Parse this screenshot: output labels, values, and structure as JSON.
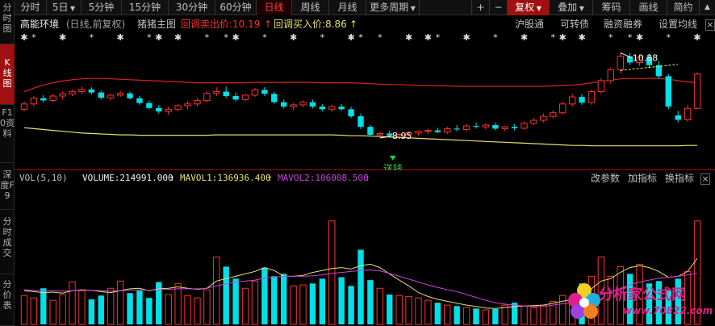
{
  "left_tabs": [
    {
      "label": "分时图",
      "active": false
    },
    {
      "label": "K线图",
      "active": true
    },
    {
      "label": "F10资料",
      "active": false
    },
    {
      "label": "深度F9",
      "active": false
    },
    {
      "label": "分时成交",
      "active": false
    },
    {
      "label": "分价表",
      "active": false
    }
  ],
  "periods": [
    "分时",
    "5日",
    "5分钟",
    "15分钟",
    "30分钟",
    "60分钟",
    "日线",
    "周线",
    "月线",
    "更多周期"
  ],
  "active_period": "日线",
  "toolbar": {
    "plus": "+",
    "minus": "−",
    "fuquan": "复权",
    "overlay": "叠加",
    "chips": "筹码",
    "drawline": "画线",
    "simple": "简约",
    "collapse": "▲"
  },
  "info": {
    "stock_name": "高能环境",
    "mode": "(日线,前复权)",
    "indicator": "猪猪主图",
    "sell_label": "回调卖出价:10.19",
    "buy_label": "回调买入价:8.86",
    "up_arrow": "↑",
    "right_links": [
      "沪股通",
      "可转债",
      "融资融券",
      "设置均线"
    ],
    "close": "×"
  },
  "chart_annotations": {
    "high_label": "10.88",
    "low_label": "8.95",
    "signal_label": "送钱"
  },
  "volume": {
    "indicator": "VOL(5,10)",
    "volume_label": "VOLUME:214991.000",
    "mavol1_label": "MAVOL1:136936.400",
    "mavol2_label": "MAVOL2:106008.500",
    "arrow": "↑",
    "tools": [
      "改参数",
      "加指标",
      "换指标"
    ],
    "close": "×"
  },
  "watermark": {
    "name": "分析家公式网",
    "url": "www.70822.com"
  },
  "colors": {
    "up": "#ff3030",
    "down": "#00e0e8",
    "ma_red": "#e02020",
    "ma_yellow": "#e8e070",
    "mavol1": "#e8e070",
    "mavol2": "#d040e0",
    "accent": "#a01010"
  },
  "chart_data": {
    "type": "candlestick",
    "price_min": 8.6,
    "price_max": 11.2,
    "candles": [
      {
        "o": 9.6,
        "h": 9.78,
        "l": 9.55,
        "c": 9.72
      },
      {
        "o": 9.72,
        "h": 9.9,
        "l": 9.66,
        "c": 9.85
      },
      {
        "o": 9.85,
        "h": 9.92,
        "l": 9.75,
        "c": 9.8
      },
      {
        "o": 9.8,
        "h": 9.95,
        "l": 9.76,
        "c": 9.9
      },
      {
        "o": 9.9,
        "h": 10.0,
        "l": 9.82,
        "c": 9.95
      },
      {
        "o": 9.95,
        "h": 10.05,
        "l": 9.9,
        "c": 10.0
      },
      {
        "o": 10.0,
        "h": 10.12,
        "l": 9.95,
        "c": 10.05
      },
      {
        "o": 10.05,
        "h": 10.1,
        "l": 9.93,
        "c": 9.98
      },
      {
        "o": 9.98,
        "h": 10.02,
        "l": 9.82,
        "c": 9.86
      },
      {
        "o": 9.86,
        "h": 9.95,
        "l": 9.8,
        "c": 9.92
      },
      {
        "o": 9.92,
        "h": 10.02,
        "l": 9.88,
        "c": 9.96
      },
      {
        "o": 9.96,
        "h": 10.0,
        "l": 9.82,
        "c": 9.85
      },
      {
        "o": 9.85,
        "h": 9.9,
        "l": 9.7,
        "c": 9.74
      },
      {
        "o": 9.74,
        "h": 9.8,
        "l": 9.6,
        "c": 9.63
      },
      {
        "o": 9.63,
        "h": 9.7,
        "l": 9.5,
        "c": 9.55
      },
      {
        "o": 9.55,
        "h": 9.66,
        "l": 9.48,
        "c": 9.6
      },
      {
        "o": 9.6,
        "h": 9.72,
        "l": 9.55,
        "c": 9.68
      },
      {
        "o": 9.68,
        "h": 9.78,
        "l": 9.6,
        "c": 9.72
      },
      {
        "o": 9.72,
        "h": 9.86,
        "l": 9.66,
        "c": 9.8
      },
      {
        "o": 9.8,
        "h": 10.02,
        "l": 9.75,
        "c": 9.96
      },
      {
        "o": 9.96,
        "h": 10.1,
        "l": 9.9,
        "c": 10.0
      },
      {
        "o": 10.0,
        "h": 10.12,
        "l": 9.85,
        "c": 9.9
      },
      {
        "o": 9.9,
        "h": 9.98,
        "l": 9.78,
        "c": 9.82
      },
      {
        "o": 9.82,
        "h": 9.95,
        "l": 9.78,
        "c": 9.92
      },
      {
        "o": 9.92,
        "h": 10.08,
        "l": 9.88,
        "c": 10.04
      },
      {
        "o": 10.04,
        "h": 10.1,
        "l": 9.9,
        "c": 9.95
      },
      {
        "o": 9.95,
        "h": 10.0,
        "l": 9.72,
        "c": 9.76
      },
      {
        "o": 9.76,
        "h": 9.82,
        "l": 9.62,
        "c": 9.66
      },
      {
        "o": 9.66,
        "h": 9.74,
        "l": 9.58,
        "c": 9.7
      },
      {
        "o": 9.7,
        "h": 9.8,
        "l": 9.64,
        "c": 9.76
      },
      {
        "o": 9.76,
        "h": 9.82,
        "l": 9.62,
        "c": 9.66
      },
      {
        "o": 9.66,
        "h": 9.72,
        "l": 9.55,
        "c": 9.6
      },
      {
        "o": 9.6,
        "h": 9.7,
        "l": 9.54,
        "c": 9.66
      },
      {
        "o": 9.66,
        "h": 9.72,
        "l": 9.56,
        "c": 9.6
      },
      {
        "o": 9.6,
        "h": 9.66,
        "l": 9.4,
        "c": 9.44
      },
      {
        "o": 9.44,
        "h": 9.5,
        "l": 9.15,
        "c": 9.2
      },
      {
        "o": 9.2,
        "h": 9.24,
        "l": 8.98,
        "c": 9.02
      },
      {
        "o": 9.02,
        "h": 9.08,
        "l": 8.95,
        "c": 9.05
      },
      {
        "o": 9.05,
        "h": 9.12,
        "l": 8.98,
        "c": 9.0
      },
      {
        "o": 9.0,
        "h": 9.06,
        "l": 8.96,
        "c": 9.03
      },
      {
        "o": 9.03,
        "h": 9.1,
        "l": 8.98,
        "c": 9.06
      },
      {
        "o": 9.06,
        "h": 9.12,
        "l": 9.0,
        "c": 9.1
      },
      {
        "o": 9.1,
        "h": 9.16,
        "l": 9.04,
        "c": 9.12
      },
      {
        "o": 9.12,
        "h": 9.18,
        "l": 9.06,
        "c": 9.08
      },
      {
        "o": 9.08,
        "h": 9.2,
        "l": 9.04,
        "c": 9.16
      },
      {
        "o": 9.16,
        "h": 9.24,
        "l": 9.1,
        "c": 9.14
      },
      {
        "o": 9.14,
        "h": 9.26,
        "l": 9.1,
        "c": 9.22
      },
      {
        "o": 9.22,
        "h": 9.3,
        "l": 9.16,
        "c": 9.2
      },
      {
        "o": 9.2,
        "h": 9.28,
        "l": 9.14,
        "c": 9.24
      },
      {
        "o": 9.24,
        "h": 9.3,
        "l": 9.12,
        "c": 9.16
      },
      {
        "o": 9.16,
        "h": 9.22,
        "l": 9.1,
        "c": 9.2
      },
      {
        "o": 9.2,
        "h": 9.26,
        "l": 9.12,
        "c": 9.17
      },
      {
        "o": 9.17,
        "h": 9.32,
        "l": 9.14,
        "c": 9.28
      },
      {
        "o": 9.28,
        "h": 9.4,
        "l": 9.24,
        "c": 9.35
      },
      {
        "o": 9.35,
        "h": 9.5,
        "l": 9.3,
        "c": 9.44
      },
      {
        "o": 9.44,
        "h": 9.58,
        "l": 9.4,
        "c": 9.52
      },
      {
        "o": 9.52,
        "h": 9.78,
        "l": 9.48,
        "c": 9.72
      },
      {
        "o": 9.72,
        "h": 9.95,
        "l": 9.66,
        "c": 9.88
      },
      {
        "o": 9.88,
        "h": 9.95,
        "l": 9.7,
        "c": 9.75
      },
      {
        "o": 9.75,
        "h": 10.05,
        "l": 9.7,
        "c": 10.0
      },
      {
        "o": 10.0,
        "h": 10.3,
        "l": 9.95,
        "c": 10.25
      },
      {
        "o": 10.25,
        "h": 10.55,
        "l": 10.18,
        "c": 10.5
      },
      {
        "o": 10.5,
        "h": 10.88,
        "l": 10.42,
        "c": 10.8
      },
      {
        "o": 10.8,
        "h": 10.88,
        "l": 10.6,
        "c": 10.66
      },
      {
        "o": 10.66,
        "h": 10.85,
        "l": 10.58,
        "c": 10.78
      },
      {
        "o": 10.78,
        "h": 10.86,
        "l": 10.55,
        "c": 10.6
      },
      {
        "o": 10.6,
        "h": 10.7,
        "l": 10.3,
        "c": 10.35
      },
      {
        "o": 10.35,
        "h": 10.4,
        "l": 9.6,
        "c": 9.66
      },
      {
        "o": 9.46,
        "h": 9.56,
        "l": 9.3,
        "c": 9.36
      },
      {
        "o": 9.36,
        "h": 9.7,
        "l": 9.32,
        "c": 9.62
      },
      {
        "o": 9.62,
        "h": 10.44,
        "l": 9.6,
        "c": 10.4
      }
    ],
    "ma_red": [
      10.0,
      10.08,
      10.15,
      10.2,
      10.24,
      10.27,
      10.29,
      10.3,
      10.3,
      10.29,
      10.28,
      10.27,
      10.26,
      10.25,
      10.24,
      10.23,
      10.22,
      10.21,
      10.2,
      10.2,
      10.2,
      10.2,
      10.2,
      10.2,
      10.21,
      10.21,
      10.21,
      10.21,
      10.21,
      10.21,
      10.21,
      10.2,
      10.2,
      10.2,
      10.2,
      10.19,
      10.18,
      10.17,
      10.16,
      10.16,
      10.15,
      10.14,
      10.14,
      10.13,
      10.13,
      10.12,
      10.12,
      10.12,
      10.12,
      10.12,
      10.12,
      10.12,
      10.12,
      10.12,
      10.12,
      10.13,
      10.14,
      10.15,
      10.17,
      10.2,
      10.23,
      10.26,
      10.29,
      10.3,
      10.3,
      10.3,
      10.3,
      10.28,
      10.25,
      10.22,
      10.2
    ],
    "ma_yellow": [
      9.18,
      9.16,
      9.14,
      9.12,
      9.1,
      9.08,
      9.06,
      9.05,
      9.04,
      9.03,
      9.02,
      9.02,
      9.01,
      9.01,
      9.01,
      9.01,
      9.01,
      9.01,
      9.01,
      9.01,
      9.02,
      9.02,
      9.02,
      9.02,
      9.02,
      9.02,
      9.02,
      9.02,
      9.02,
      9.02,
      9.02,
      9.02,
      9.02,
      9.01,
      9.0,
      9.0,
      8.99,
      8.98,
      8.97,
      8.96,
      8.95,
      8.94,
      8.93,
      8.92,
      8.91,
      8.9,
      8.89,
      8.88,
      8.87,
      8.86,
      8.85,
      8.84,
      8.83,
      8.82,
      8.81,
      8.8,
      8.79,
      8.78,
      8.78,
      8.77,
      8.77,
      8.77,
      8.77,
      8.77,
      8.77,
      8.77,
      8.77,
      8.77,
      8.77,
      8.78,
      8.78
    ],
    "volume_max": 280000,
    "volumes": [
      60000,
      55000,
      75000,
      50000,
      62000,
      88000,
      70000,
      52000,
      60000,
      75000,
      90000,
      65000,
      70000,
      55000,
      88000,
      62000,
      85000,
      60000,
      55000,
      72000,
      140000,
      120000,
      95000,
      75000,
      90000,
      118000,
      100000,
      105000,
      80000,
      82000,
      85000,
      95000,
      215000,
      98000,
      80000,
      155000,
      92000,
      75000,
      62000,
      60000,
      58000,
      55000,
      50000,
      45000,
      40000,
      38000,
      35000,
      33000,
      30000,
      32000,
      40000,
      45000,
      38000,
      35000,
      40000,
      48000,
      60000,
      55000,
      85000,
      100000,
      140000,
      100000,
      120000,
      105000,
      125000,
      85000,
      90000,
      72000,
      95000,
      110000,
      214991
    ],
    "mavol1": [
      70000,
      68000,
      66000,
      67000,
      65000,
      70000,
      72000,
      71000,
      68000,
      66000,
      70000,
      74000,
      75000,
      70000,
      74000,
      75000,
      78000,
      75000,
      73000,
      75000,
      90000,
      95000,
      100000,
      105000,
      110000,
      118000,
      112000,
      100000,
      100000,
      102000,
      108000,
      112000,
      116000,
      118000,
      115000,
      122000,
      125000,
      118000,
      105000,
      92000,
      80000,
      66000,
      58000,
      52000,
      48000,
      44000,
      40000,
      37000,
      34000,
      33000,
      35000,
      37000,
      38000,
      39000,
      40000,
      44000,
      48000,
      52000,
      62000,
      74000,
      90000,
      95000,
      108000,
      118000,
      122000,
      118000,
      110000,
      98000,
      100000,
      110000,
      136936
    ],
    "mavol2": [
      72000,
      71000,
      70000,
      70000,
      69000,
      70000,
      71000,
      71000,
      70000,
      69000,
      70000,
      71000,
      72000,
      71000,
      72000,
      73000,
      74000,
      74000,
      74000,
      75000,
      80000,
      84000,
      88000,
      90000,
      92000,
      96000,
      98000,
      100000,
      100000,
      100000,
      101000,
      103000,
      106000,
      108000,
      110000,
      112000,
      113000,
      111000,
      106000,
      100000,
      94000,
      88000,
      82000,
      77000,
      72000,
      68000,
      62000,
      56000,
      50000,
      45000,
      42000,
      40000,
      38000,
      37000,
      37000,
      40000,
      43000,
      45000,
      50000,
      55000,
      62000,
      68000,
      75000,
      82000,
      88000,
      92000,
      96000,
      98000,
      100000,
      103000,
      106008
    ]
  }
}
